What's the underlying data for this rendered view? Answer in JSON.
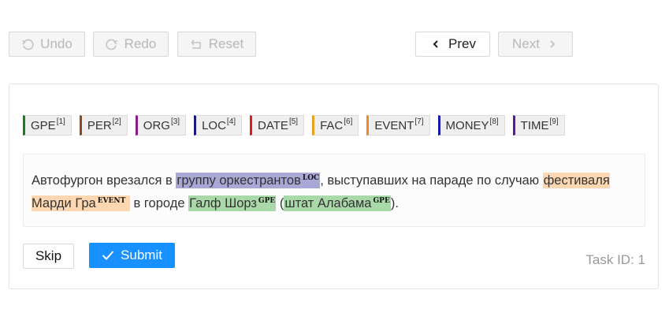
{
  "toolbar": {
    "undo": {
      "label": "Undo",
      "icon": "undo-icon"
    },
    "redo": {
      "label": "Redo",
      "icon": "redo-icon"
    },
    "reset": {
      "label": "Reset",
      "icon": "reset-icon"
    },
    "prev": {
      "label": "Prev",
      "icon": "chevron-left-icon"
    },
    "next": {
      "label": "Next",
      "icon": "chevron-right-icon"
    }
  },
  "labels": [
    {
      "name": "GPE",
      "hotkey": "[1]",
      "color": "#1a7f1a"
    },
    {
      "name": "PER",
      "hotkey": "[2]",
      "color": "#8b4a1c"
    },
    {
      "name": "ORG",
      "hotkey": "[3]",
      "color": "#8a1a8a"
    },
    {
      "name": "LOC",
      "hotkey": "[4]",
      "color": "#1a1a7f"
    },
    {
      "name": "DATE",
      "hotkey": "[5]",
      "color": "#e01b1b"
    },
    {
      "name": "FAC",
      "hotkey": "[6]",
      "color": "#e8a020"
    },
    {
      "name": "EVENT",
      "hotkey": "[7]",
      "color": "#f08a20"
    },
    {
      "name": "MONEY",
      "hotkey": "[8]",
      "color": "#1a1aa8"
    },
    {
      "name": "TIME",
      "hotkey": "[9]",
      "color": "#5a1a9a"
    }
  ],
  "text": {
    "seg1": "Автофургон врезался в ",
    "ent1": {
      "text": "группу оркестрантов",
      "tag": "LOC"
    },
    "seg2": ", выступавших на параде по случаю ",
    "ent2": {
      "text": "фестиваля Марди Гра",
      "tag": "EVENT"
    },
    "seg3": " в городе ",
    "ent3": {
      "text": "Галф Шорз",
      "tag": "GPE"
    },
    "seg4": " (",
    "ent4": {
      "text": "штат Алабама",
      "tag": "GPE"
    },
    "seg5": ")."
  },
  "actions": {
    "skip": "Skip",
    "submit": "Submit"
  },
  "task_id": "Task ID: 1"
}
